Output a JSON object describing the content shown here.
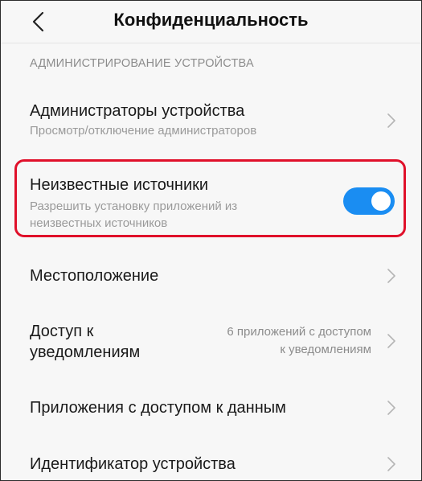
{
  "header": {
    "title": "Конфиденциальность",
    "back_icon": "chevron-left-icon"
  },
  "section": {
    "label": "АДМИНИСТРИРОВАНИЕ УСТРОЙСТВА"
  },
  "rows": {
    "device_admins": {
      "title": "Администраторы устройства",
      "subtitle": "Просмотр/отключение администраторов"
    },
    "unknown_sources": {
      "title": "Неизвестные источники",
      "subtitle_line1": "Разрешить установку приложений из",
      "subtitle_line2": "неизвестных источников",
      "toggle_state": "on"
    },
    "location": {
      "title": "Местоположение"
    },
    "notification_access": {
      "title_line1": "Доступ к",
      "title_line2": "уведомлениям",
      "value_line1": "6 приложений с доступом",
      "value_line2": "к уведомлениям"
    },
    "data_access_apps": {
      "title": "Приложения с доступом к данным"
    },
    "device_id": {
      "title": "Идентификатор устройства"
    }
  },
  "colors": {
    "toggle_on": "#1a8df2",
    "highlight": "#e0102a",
    "background": "#f7f7f7"
  }
}
